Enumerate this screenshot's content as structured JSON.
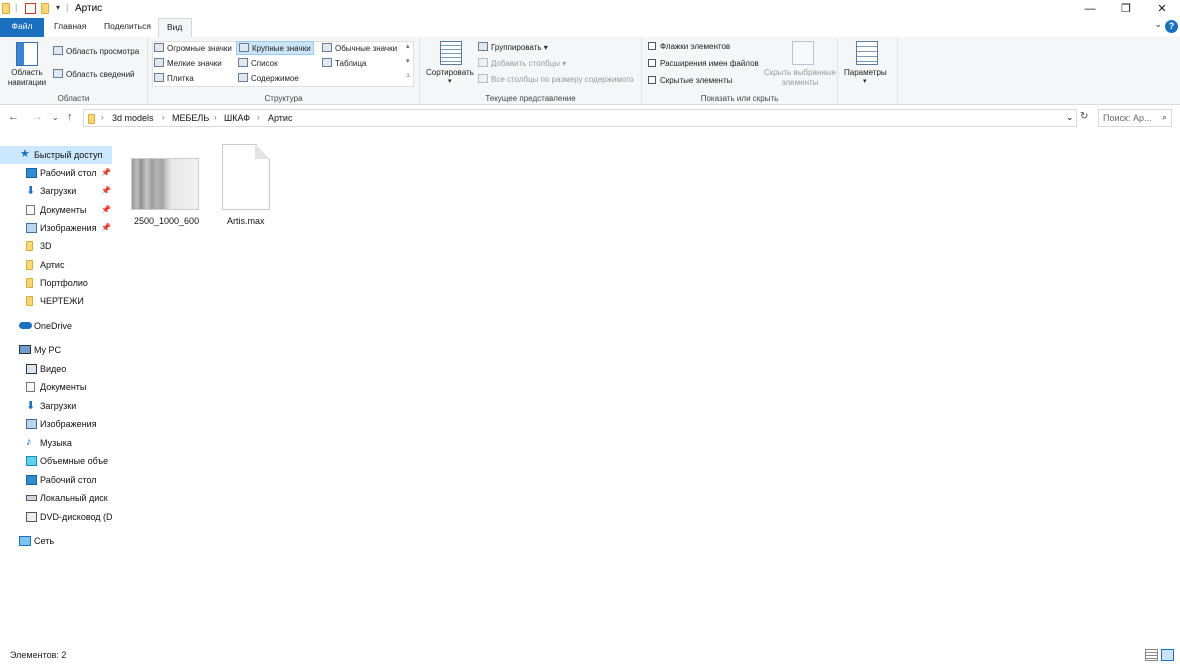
{
  "window": {
    "title": "Артис",
    "minimize": "—",
    "maximize": "❐",
    "close": "✕"
  },
  "tabs": [
    {
      "label": "Файл"
    },
    {
      "label": "Главная"
    },
    {
      "label": "Поделиться"
    },
    {
      "label": "Вид"
    }
  ],
  "ribbon": {
    "areas": {
      "nav_pane": "Область навигации",
      "preview": "Область просмотра",
      "details": "Область сведений",
      "group": "Области"
    },
    "layout": {
      "items": [
        "Огромные значки",
        "Крупные значки",
        "Обычные значки",
        "Мелкие значки",
        "Список",
        "Таблица",
        "Плитка",
        "Содержимое"
      ],
      "group": "Структура"
    },
    "current_view": {
      "sort": "Сортировать",
      "group_by": "Группировать",
      "add_columns": "Добавить столбцы",
      "fit_columns": "Все столбцы по размеру содержимого",
      "group": "Текущее представление"
    },
    "show_hide": {
      "item_checkboxes": "Флажки элементов",
      "file_extensions": "Расширения имен файлов",
      "hidden_items": "Скрытые элементы",
      "hide_selected": "Скрыть выбранные элементы",
      "group": "Показать или скрыть"
    },
    "options": "Параметры"
  },
  "address": {
    "crumbs": [
      "3d models",
      "МЕБЕЛЬ",
      "ШКАФ",
      "Артис"
    ],
    "search_placeholder": "Поиск: Ар..."
  },
  "sidebar": {
    "quick_access": "Быстрый доступ",
    "quick_items": [
      {
        "label": "Рабочий стол",
        "pinned": true
      },
      {
        "label": "Загрузки",
        "pinned": true
      },
      {
        "label": "Документы",
        "pinned": true
      },
      {
        "label": "Изображения",
        "pinned": true
      },
      {
        "label": "3D",
        "pinned": false
      },
      {
        "label": "Артис",
        "pinned": false
      },
      {
        "label": "Портфолио",
        "pinned": false
      },
      {
        "label": "ЧЕРТЕЖИ",
        "pinned": false
      }
    ],
    "onedrive": "OneDrive",
    "mypc": "My PC",
    "pc_items": [
      "Видео",
      "Документы",
      "Загрузки",
      "Изображения",
      "Музыка",
      "Объемные объе",
      "Рабочий стол",
      "Локальный диск",
      "DVD-дисковод (D"
    ],
    "network": "Сеть"
  },
  "files": [
    {
      "name": "2500_1000_600",
      "type": "image"
    },
    {
      "name": "Artis.max",
      "type": "document"
    }
  ],
  "status": {
    "count": "Элементов: 2"
  },
  "colors": {
    "accent": "#1a6fbf",
    "selection": "#cce8ff",
    "folder": "#f8d775"
  }
}
